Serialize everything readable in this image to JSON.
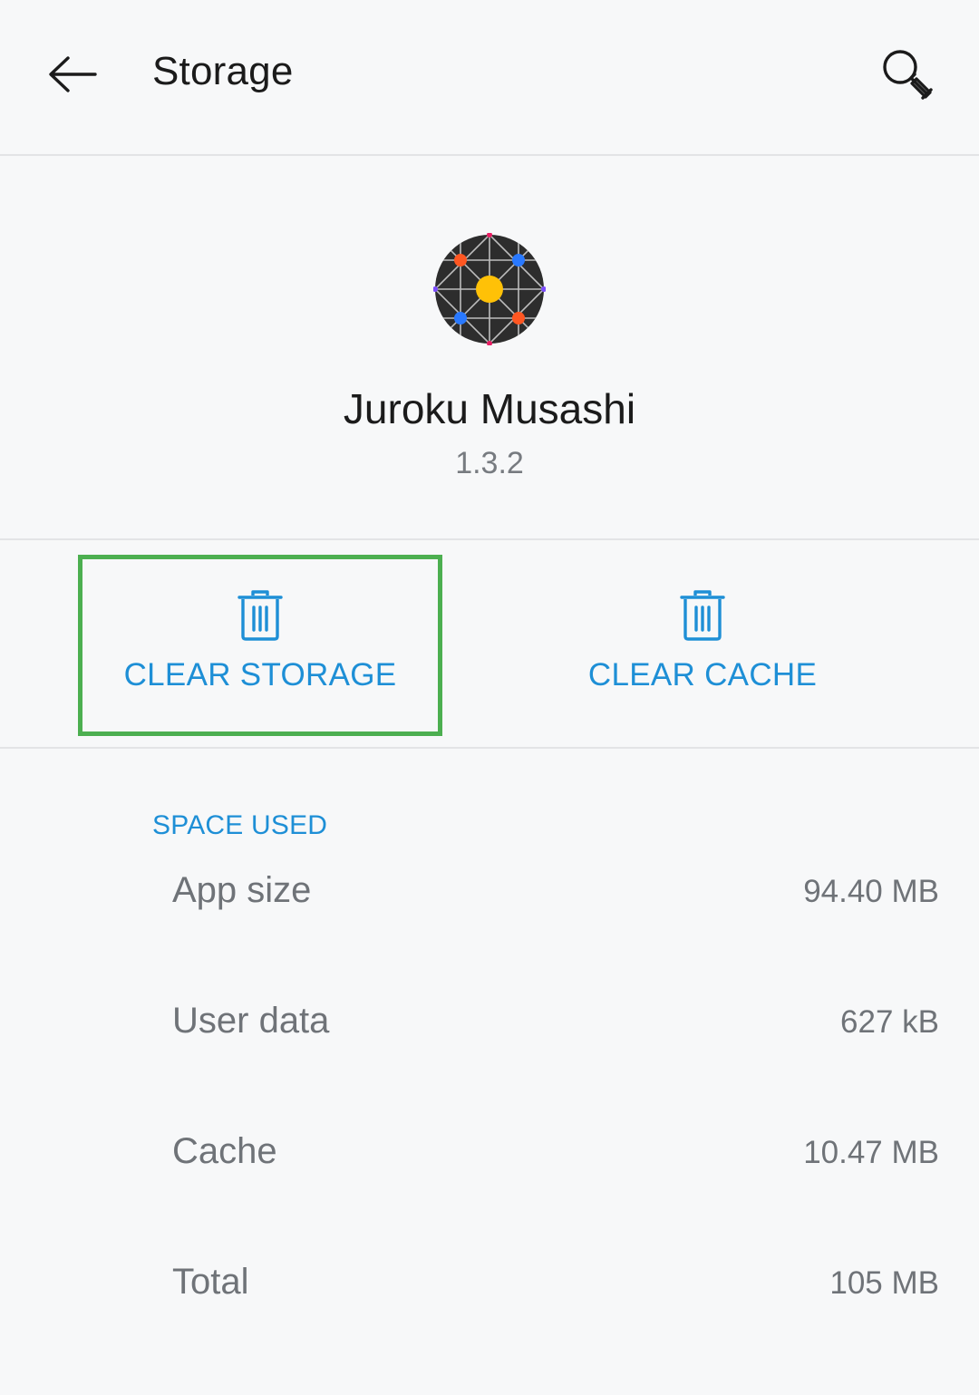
{
  "header": {
    "title": "Storage",
    "back_icon": "arrow-left-icon",
    "search_icon": "search-icon"
  },
  "app": {
    "name": "Juroku Musashi",
    "version": "1.3.2",
    "icon": "app-icon"
  },
  "actions": {
    "clear_storage": "CLEAR STORAGE",
    "clear_cache": "CLEAR CACHE",
    "trash_icon": "trash-icon",
    "highlight_color": "#4caf50"
  },
  "space_used": {
    "section_title": "SPACE USED",
    "rows": [
      {
        "label": "App size",
        "value": "94.40 MB"
      },
      {
        "label": "User data",
        "value": "627 kB"
      },
      {
        "label": "Cache",
        "value": "10.47 MB"
      },
      {
        "label": "Total",
        "value": "105 MB"
      }
    ]
  },
  "colors": {
    "accent": "#1e8fd6",
    "background": "#f7f8f9",
    "divider": "#e3e4e6",
    "text_secondary": "#6f7378"
  }
}
